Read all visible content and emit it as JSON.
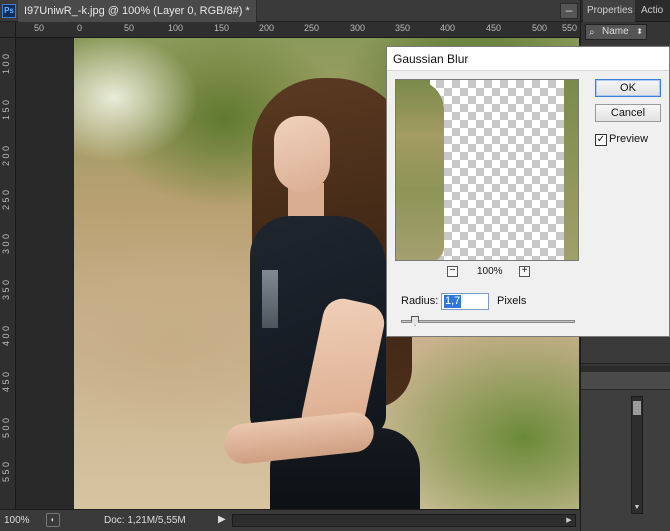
{
  "app": {
    "logo": "Ps",
    "document_tab": "I97UniwR_-k.jpg @ 100% (Layer 0, RGB/8#) *",
    "minimize_glyph": "–",
    "close_glyph": "×"
  },
  "panel": {
    "tabs": [
      "Properties",
      "Actio"
    ],
    "filter_label": "Name",
    "filter_icon": "search-icon"
  },
  "rulers": {
    "top": [
      "50",
      "0",
      "50",
      "100",
      "150",
      "200",
      "250",
      "300",
      "350",
      "400",
      "450",
      "500",
      "550"
    ],
    "left": [
      "1 0 0",
      "1 5 0",
      "2 0 0",
      "2 5 0",
      "3 0 0",
      "3 5 0",
      "4 0 0",
      "4 5 0",
      "5 0 0",
      "5 5 0"
    ]
  },
  "status": {
    "zoom": "100%",
    "doc_info": "Doc: 1,21M/5,55M",
    "arrow_glyph": "▶"
  },
  "dialog": {
    "title": "Gaussian Blur",
    "ok_label": "OK",
    "cancel_label": "Cancel",
    "preview_label": "Preview",
    "preview_checked": "✓",
    "zoom_out": "−",
    "zoom_in": "+",
    "zoom_level": "100%",
    "radius_label": "Radius:",
    "radius_value": "1,7",
    "radius_unit": "Pixels"
  },
  "colors": {
    "workspace": "#282828",
    "panel": "#353535",
    "dialog_bg": "#f0f0f0",
    "selection": "#3078d8"
  }
}
